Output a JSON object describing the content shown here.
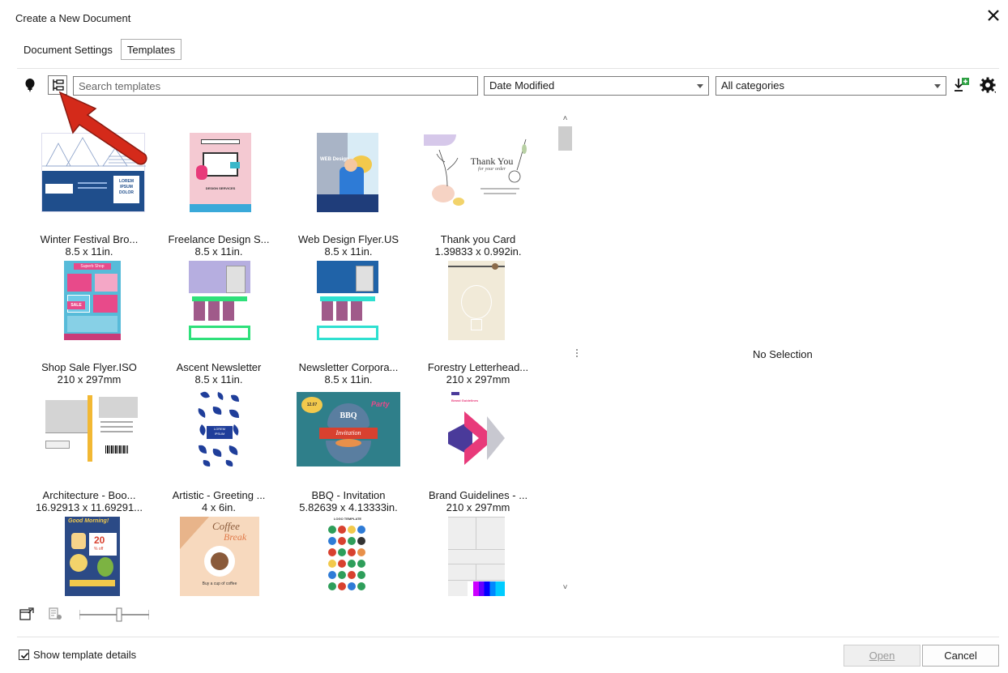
{
  "window": {
    "title": "Create a New Document",
    "close_glyph": "✕"
  },
  "tabs": [
    {
      "label": "Document Settings",
      "active": false
    },
    {
      "label": "Templates",
      "active": true
    }
  ],
  "toolbar": {
    "search_placeholder": "Search templates",
    "sort": {
      "selected": "Date Modified"
    },
    "category": {
      "selected": "All categories"
    },
    "icons": [
      "bulb-icon",
      "tree-view-icon",
      "import-template-icon",
      "settings-icon"
    ]
  },
  "templates": [
    {
      "name": "Winter Festival Bro...",
      "size": "8.5 x 11in."
    },
    {
      "name": "Freelance Design S...",
      "size": "8.5 x 11in."
    },
    {
      "name": "Web Design Flyer.US",
      "size": "8.5 x 11in."
    },
    {
      "name": "Thank you Card",
      "size": "1.39833 x 0.992in."
    },
    {
      "name": "Shop Sale Flyer.ISO",
      "size": "210 x 297mm"
    },
    {
      "name": "Ascent Newsletter",
      "size": "8.5 x 11in."
    },
    {
      "name": "Newsletter Corpora...",
      "size": "8.5 x 11in."
    },
    {
      "name": "Forestry Letterhead...",
      "size": "210 x 297mm"
    },
    {
      "name": "Architecture - Boo...",
      "size": "16.92913 x 11.69291..."
    },
    {
      "name": "Artistic - Greeting ...",
      "size": "4 x 6in."
    },
    {
      "name": "BBQ - Invitation",
      "size": "5.82639 x 4.13333in."
    },
    {
      "name": "Brand Guidelines - ...",
      "size": "210 x 297mm"
    },
    {
      "name": "",
      "size": ""
    },
    {
      "name": "",
      "size": ""
    },
    {
      "name": "",
      "size": ""
    },
    {
      "name": "",
      "size": ""
    }
  ],
  "thumbnail_text": {
    "winter": [
      "LOREM",
      "IPSUM",
      "DOLOR"
    ],
    "freelance": "DESIGN SERVICES",
    "web": "WEB Design",
    "thankyou": [
      "Thank You",
      "for your order"
    ],
    "shop": [
      "Superb Shop",
      "SALE"
    ],
    "bbq": [
      "12.07",
      "BBQ",
      "Party",
      "Invitation"
    ],
    "artistic": [
      "LOREM",
      "IPSUM"
    ],
    "brand": "Brand Guidelines",
    "goodmorning": [
      "Good Morning!",
      "20",
      "% off"
    ],
    "coffee": [
      "Coffee",
      "Break",
      "Buy a cup of coffee"
    ],
    "logos": "LOGO TEMPLATE"
  },
  "preview": {
    "empty_text": "No Selection"
  },
  "footer": {
    "show_details_label": "Show template details",
    "show_details_checked": true,
    "open_label": "Open",
    "cancel_label": "Cancel"
  },
  "colors": {
    "annotation_arrow": "#d42a1a",
    "accent_blue": "#1f4e8c"
  }
}
